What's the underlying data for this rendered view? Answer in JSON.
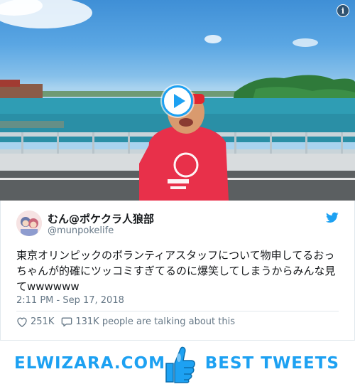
{
  "video": {
    "info_label": "i",
    "play_icon": "play-icon"
  },
  "tweet": {
    "author_name": "むん@ポケクラ人狼部",
    "author_handle": "@munpokelife",
    "text": "東京オリンピックのボランティアスタッフについて物申してるおっちゃんが的確にツッコミすぎてるのに爆笑してしまうからみんな見てwwwwww",
    "timestamp": "2:11 PM - Sep 17, 2018",
    "likes": "251K",
    "talking": "131K people are talking about this"
  },
  "banner": {
    "site": "ELWIZARA.COM",
    "label": "BEST TWEETS"
  },
  "colors": {
    "twitter_blue": "#1da1f2",
    "secondary_text": "#657786",
    "border": "#e1e8ed"
  }
}
